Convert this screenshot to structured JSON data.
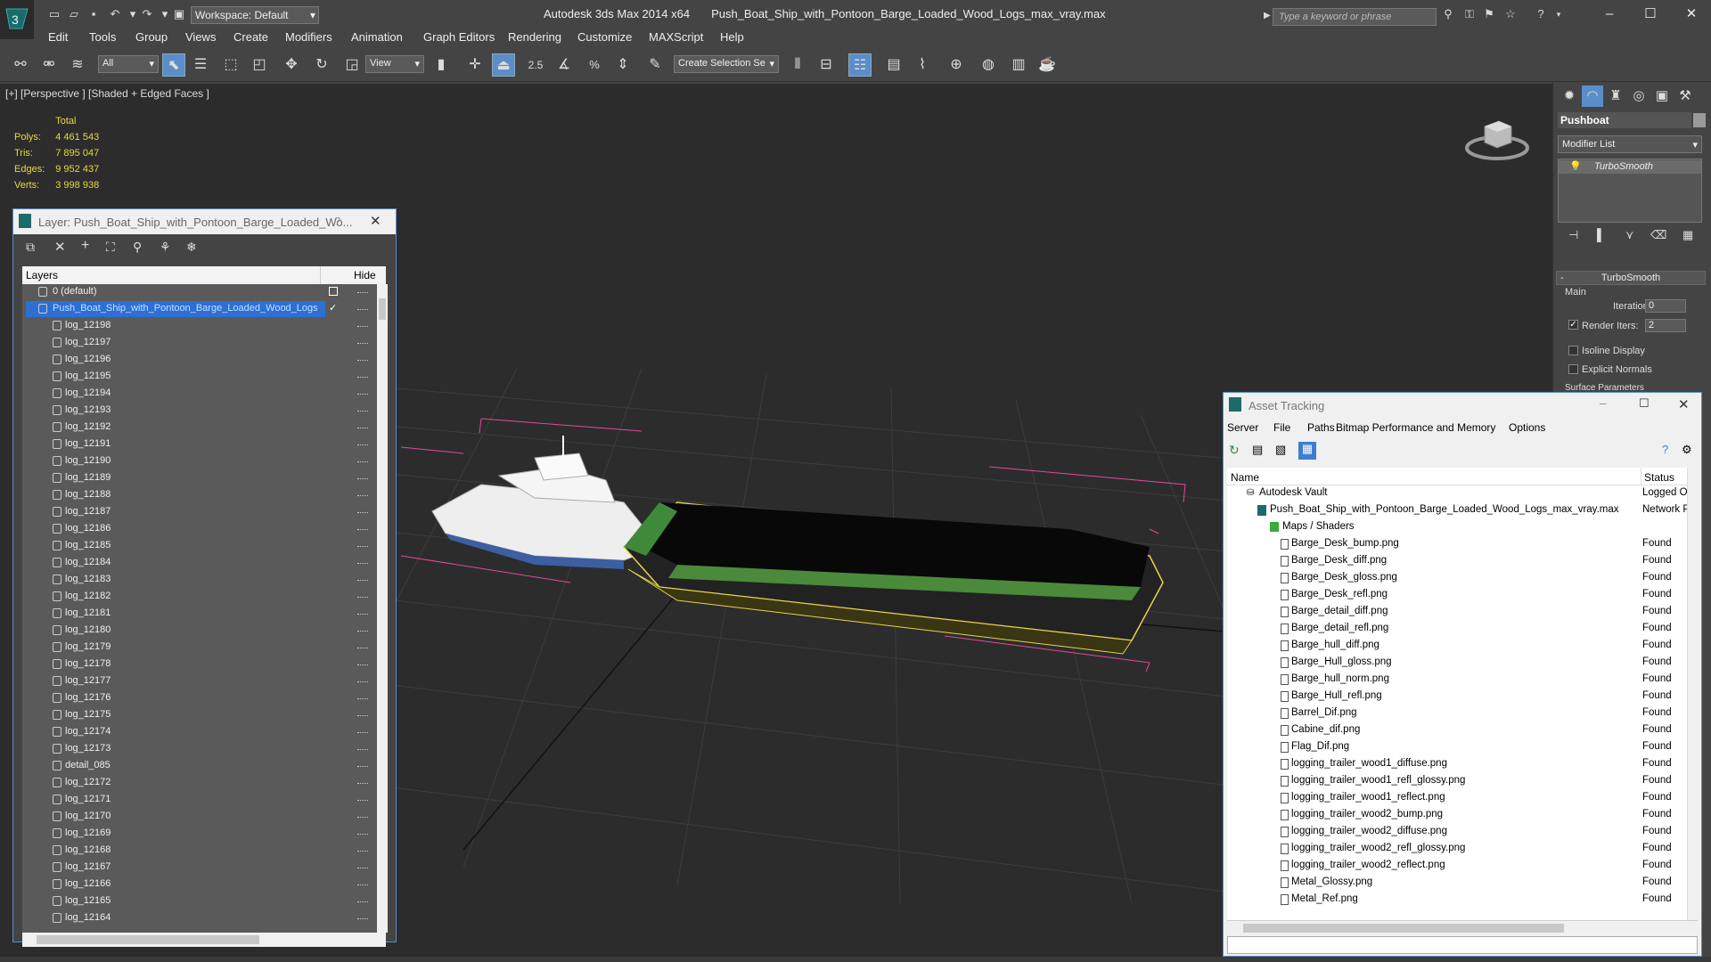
{
  "titlebar": {
    "workspace": "Workspace: Default",
    "app": "Autodesk 3ds Max  2014 x64",
    "file": "Push_Boat_Ship_with_Pontoon_Barge_Loaded_Wood_Logs_max_vray.max",
    "search_placeholder": "Type a keyword or phrase"
  },
  "menu": [
    "Edit",
    "Tools",
    "Group",
    "Views",
    "Create",
    "Modifiers",
    "Animation",
    "Graph Editors",
    "Rendering",
    "Customize",
    "MAXScript",
    "Help"
  ],
  "toolbar": {
    "filter": "All",
    "refcoord": "View",
    "snap_angle": "2.5",
    "selection_set": "Create Selection Se"
  },
  "viewport": {
    "label": "[+] [Perspective ] [Shaded + Edged Faces ]",
    "stats_header": "Total",
    "stats": [
      {
        "k": "Polys:",
        "v": "4 461 543"
      },
      {
        "k": "Tris:",
        "v": "7 895 047"
      },
      {
        "k": "Edges:",
        "v": "9 952 437"
      },
      {
        "k": "Verts:",
        "v": "3 998 938"
      }
    ]
  },
  "command_panel": {
    "object_name": "Pushboat",
    "modifier_list": "Modifier List",
    "stack_item": "TurboSmooth",
    "rollout": "TurboSmooth",
    "main": "Main",
    "iterations_label": "Iterations:",
    "iterations": "0",
    "render_iters_label": "Render Iters:",
    "render_iters": "2",
    "isoline": "Isoline Display",
    "explicit_normals": "Explicit Normals",
    "surface_params": "Surface Parameters"
  },
  "layer_dialog": {
    "title": "Layer: Push_Boat_Ship_with_Pontoon_Barge_Loaded_Wo...",
    "help": "?",
    "col_layers": "Layers",
    "col_hide": "Hide",
    "default_layer": "0 (default)",
    "active_layer": "Push_Boat_Ship_with_Pontoon_Barge_Loaded_Wood_Logs",
    "items": [
      "log_12198",
      "log_12197",
      "log_12196",
      "log_12195",
      "log_12194",
      "log_12193",
      "log_12192",
      "log_12191",
      "log_12190",
      "log_12189",
      "log_12188",
      "log_12187",
      "log_12186",
      "log_12185",
      "log_12184",
      "log_12183",
      "log_12182",
      "log_12181",
      "log_12180",
      "log_12179",
      "log_12178",
      "log_12177",
      "log_12176",
      "log_12175",
      "log_12174",
      "log_12173",
      "detail_085",
      "log_12172",
      "log_12171",
      "log_12170",
      "log_12169",
      "log_12168",
      "log_12167",
      "log_12166",
      "log_12165",
      "log_12164"
    ]
  },
  "asset_tracking": {
    "title": "Asset Tracking",
    "menu": [
      "Server",
      "File",
      "Paths",
      "Bitmap Performance and Memory",
      "Options"
    ],
    "col_name": "Name",
    "col_status": "Status",
    "vault": "Autodesk Vault",
    "vault_status": "Logged Ou",
    "file": "Push_Boat_Ship_with_Pontoon_Barge_Loaded_Wood_Logs_max_vray.max",
    "file_status": "Network P",
    "maps": "Maps / Shaders",
    "found": "Found",
    "assets": [
      "Barge_Desk_bump.png",
      "Barge_Desk_diff.png",
      "Barge_Desk_gloss.png",
      "Barge_Desk_refl.png",
      "Barge_detail_diff.png",
      "Barge_detail_refl.png",
      "Barge_hull_diff.png",
      "Barge_Hull_gloss.png",
      "Barge_hull_norm.png",
      "Barge_Hull_refl.png",
      "Barrel_Dif.png",
      "Cabine_dif.png",
      "Flag_Dif.png",
      "logging_trailer_wood1_diffuse.png",
      "logging_trailer_wood1_refl_glossy.png",
      "logging_trailer_wood1_reflect.png",
      "logging_trailer_wood2_bump.png",
      "logging_trailer_wood2_diffuse.png",
      "logging_trailer_wood2_refl_glossy.png",
      "logging_trailer_wood2_reflect.png",
      "Metal_Glossy.png",
      "Metal_Ref.png"
    ]
  }
}
